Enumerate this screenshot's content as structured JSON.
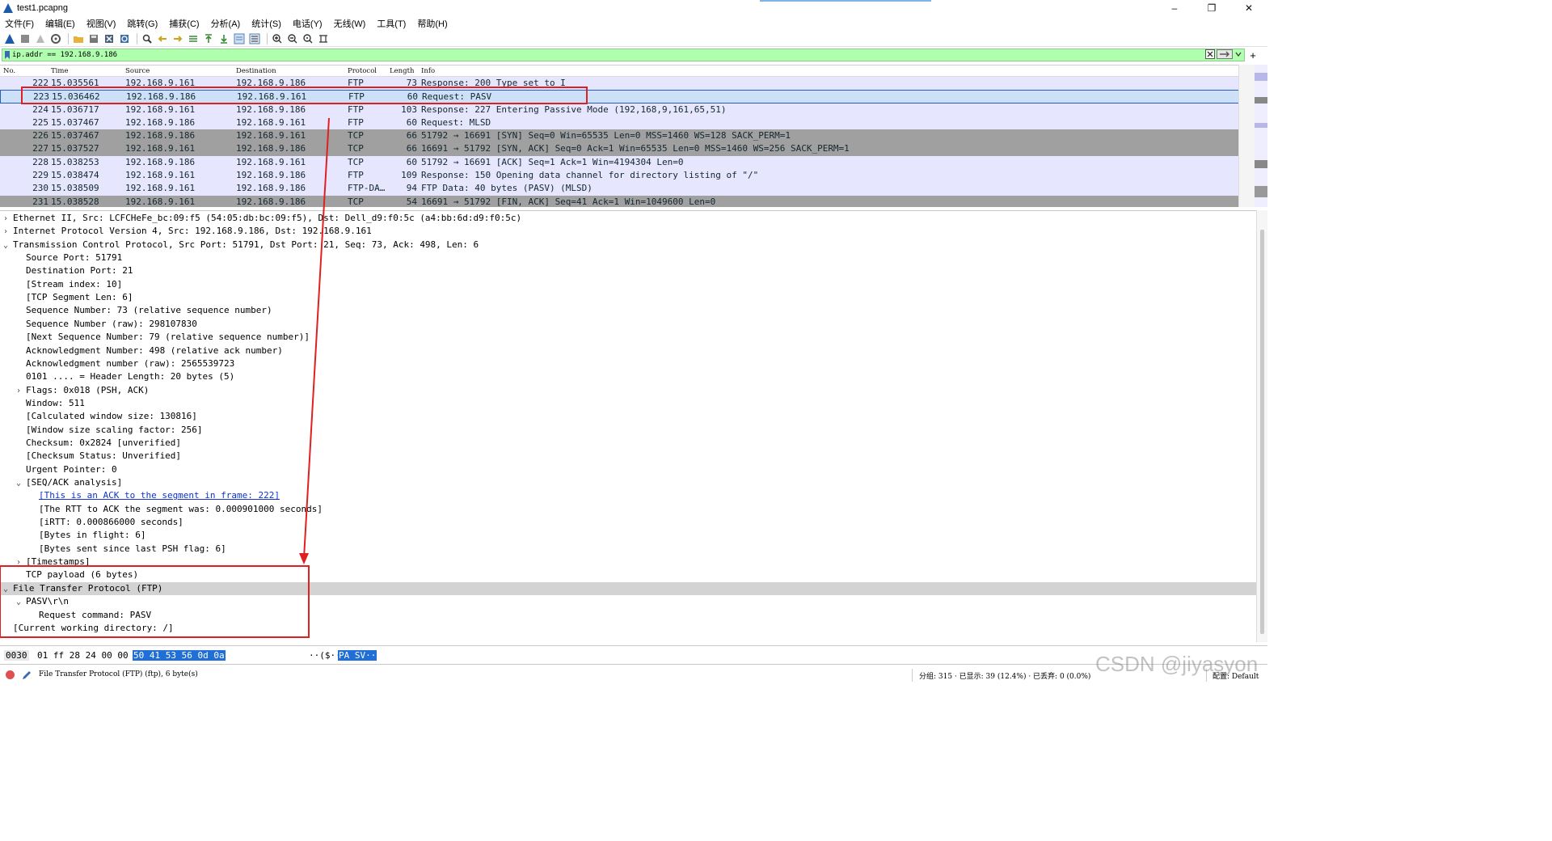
{
  "window": {
    "title": "test1.pcapng",
    "minimize": "–",
    "maximize": "❐",
    "close": "✕"
  },
  "menu": [
    "文件(F)",
    "编辑(E)",
    "视图(V)",
    "跳转(G)",
    "捕获(C)",
    "分析(A)",
    "统计(S)",
    "电话(Y)",
    "无线(W)",
    "工具(T)",
    "帮助(H)"
  ],
  "filter": {
    "value": "ip.addr == 192.168.9.186",
    "color": "#afffaf"
  },
  "packet_list": {
    "columns": {
      "no": "No.",
      "time": "Time",
      "source": "Source",
      "destination": "Destination",
      "protocol": "Protocol",
      "length": "Length",
      "info": "Info"
    },
    "rows": [
      {
        "no": "222",
        "time": "15.035561",
        "source": "192.168.9.161",
        "destination": "192.168.9.186",
        "protocol": "FTP",
        "length": "73",
        "info": "Response: 200 Type set to I",
        "bg": "#e7e6ff",
        "fg": "#12272e"
      },
      {
        "no": "223",
        "time": "15.036462",
        "source": "192.168.9.186",
        "destination": "192.168.9.161",
        "protocol": "FTP",
        "length": "60",
        "info": "Request: PASV",
        "bg": "#cce0f7",
        "fg": "#12272e",
        "selected": true
      },
      {
        "no": "224",
        "time": "15.036717",
        "source": "192.168.9.161",
        "destination": "192.168.9.186",
        "protocol": "FTP",
        "length": "103",
        "info": "Response: 227 Entering Passive Mode (192,168,9,161,65,51)",
        "bg": "#e7e6ff",
        "fg": "#12272e"
      },
      {
        "no": "225",
        "time": "15.037467",
        "source": "192.168.9.186",
        "destination": "192.168.9.161",
        "protocol": "FTP",
        "length": "60",
        "info": "Request: MLSD",
        "bg": "#e7e6ff",
        "fg": "#12272e"
      },
      {
        "no": "226",
        "time": "15.037467",
        "source": "192.168.9.186",
        "destination": "192.168.9.161",
        "protocol": "TCP",
        "length": "66",
        "info": "51792 → 16691 [SYN] Seq=0 Win=65535 Len=0 MSS=1460 WS=128 SACK_PERM=1",
        "bg": "#a0a0a0",
        "fg": "#12272e"
      },
      {
        "no": "227",
        "time": "15.037527",
        "source": "192.168.9.161",
        "destination": "192.168.9.186",
        "protocol": "TCP",
        "length": "66",
        "info": "16691 → 51792 [SYN, ACK] Seq=0 Ack=1 Win=65535 Len=0 MSS=1460 WS=256 SACK_PERM=1",
        "bg": "#a0a0a0",
        "fg": "#12272e"
      },
      {
        "no": "228",
        "time": "15.038253",
        "source": "192.168.9.186",
        "destination": "192.168.9.161",
        "protocol": "TCP",
        "length": "60",
        "info": "51792 → 16691 [ACK] Seq=1 Ack=1 Win=4194304 Len=0",
        "bg": "#e7e6ff",
        "fg": "#12272e"
      },
      {
        "no": "229",
        "time": "15.038474",
        "source": "192.168.9.161",
        "destination": "192.168.9.186",
        "protocol": "FTP",
        "length": "109",
        "info": "Response: 150 Opening data channel for directory listing of \"/\"",
        "bg": "#e7e6ff",
        "fg": "#12272e"
      },
      {
        "no": "230",
        "time": "15.038509",
        "source": "192.168.9.161",
        "destination": "192.168.9.186",
        "protocol": "FTP-DA…",
        "length": "94",
        "info": "FTP Data: 40 bytes (PASV) (MLSD)",
        "bg": "#e7e6ff",
        "fg": "#12272e"
      },
      {
        "no": "231",
        "time": "15.038528",
        "source": "192.168.9.161",
        "destination": "192.168.9.186",
        "protocol": "TCP",
        "length": "54",
        "info": "16691 → 51792 [FIN, ACK] Seq=41 Ack=1 Win=1049600 Len=0",
        "bg": "#a0a0a0",
        "fg": "#12272e"
      }
    ]
  },
  "details": [
    {
      "indent": 0,
      "arrow": "›",
      "text": "Ethernet II, Src: LCFCHeFe_bc:09:f5 (54:05:db:bc:09:f5), Dst: Dell_d9:f0:5c (a4:bb:6d:d9:f0:5c)"
    },
    {
      "indent": 0,
      "arrow": "›",
      "text": "Internet Protocol Version 4, Src: 192.168.9.186, Dst: 192.168.9.161"
    },
    {
      "indent": 0,
      "arrow": "⌄",
      "text": "Transmission Control Protocol, Src Port: 51791, Dst Port: 21, Seq: 73, Ack: 498, Len: 6"
    },
    {
      "indent": 1,
      "arrow": "",
      "text": "Source Port: 51791"
    },
    {
      "indent": 1,
      "arrow": "",
      "text": "Destination Port: 21"
    },
    {
      "indent": 1,
      "arrow": "",
      "text": "[Stream index: 10]"
    },
    {
      "indent": 1,
      "arrow": "",
      "text": "[TCP Segment Len: 6]"
    },
    {
      "indent": 1,
      "arrow": "",
      "text": "Sequence Number: 73    (relative sequence number)"
    },
    {
      "indent": 1,
      "arrow": "",
      "text": "Sequence Number (raw): 298107830"
    },
    {
      "indent": 1,
      "arrow": "",
      "text": "[Next Sequence Number: 79    (relative sequence number)]"
    },
    {
      "indent": 1,
      "arrow": "",
      "text": "Acknowledgment Number: 498    (relative ack number)"
    },
    {
      "indent": 1,
      "arrow": "",
      "text": "Acknowledgment number (raw): 2565539723"
    },
    {
      "indent": 1,
      "arrow": "",
      "text": "0101 .... = Header Length: 20 bytes (5)"
    },
    {
      "indent": 1,
      "arrow": "›",
      "text": "Flags: 0x018 (PSH, ACK)"
    },
    {
      "indent": 1,
      "arrow": "",
      "text": "Window: 511"
    },
    {
      "indent": 1,
      "arrow": "",
      "text": "[Calculated window size: 130816]"
    },
    {
      "indent": 1,
      "arrow": "",
      "text": "[Window size scaling factor: 256]"
    },
    {
      "indent": 1,
      "arrow": "",
      "text": "Checksum: 0x2824 [unverified]"
    },
    {
      "indent": 1,
      "arrow": "",
      "text": "[Checksum Status: Unverified]"
    },
    {
      "indent": 1,
      "arrow": "",
      "text": "Urgent Pointer: 0"
    },
    {
      "indent": 1,
      "arrow": "⌄",
      "text": "[SEQ/ACK analysis]"
    },
    {
      "indent": 2,
      "arrow": "",
      "text": "[This is an ACK to the segment in frame: 222]",
      "link": true
    },
    {
      "indent": 2,
      "arrow": "",
      "text": "[The RTT to ACK the segment was: 0.000901000 seconds]"
    },
    {
      "indent": 2,
      "arrow": "",
      "text": "[iRTT: 0.000866000 seconds]"
    },
    {
      "indent": 2,
      "arrow": "",
      "text": "[Bytes in flight: 6]"
    },
    {
      "indent": 2,
      "arrow": "",
      "text": "[Bytes sent since last PSH flag: 6]"
    },
    {
      "indent": 1,
      "arrow": "›",
      "text": "[Timestamps]"
    },
    {
      "indent": 1,
      "arrow": "",
      "text": "TCP payload (6 bytes)"
    },
    {
      "indent": 0,
      "arrow": "⌄",
      "text": "File Transfer Protocol (FTP)",
      "highlight": true
    },
    {
      "indent": 1,
      "arrow": "⌄",
      "text": "PASV\\r\\n"
    },
    {
      "indent": 2,
      "arrow": "",
      "text": "Request command: PASV"
    },
    {
      "indent": 0,
      "arrow": "",
      "text": "[Current working directory: /]"
    }
  ],
  "bytes": {
    "offset": "0030",
    "hex_plain": "01 ff 28 24 00 00",
    "hex_selected": "50 41  53 56 0d 0a",
    "ascii_plain": "··($··",
    "ascii_selected": "PA SV··"
  },
  "status": {
    "text": "File Transfer Protocol (FTP) (ftp), 6 byte(s)",
    "stats": "分组: 315 · 已显示: 39 (12.4%) · 已丢弃: 0 (0.0%)",
    "profile": "配置: Default"
  },
  "watermark": "CSDN @jiyasyon",
  "colors": {
    "annotation": "#e02020",
    "selection_border": "#2a5dbc",
    "byte_highlight": "#1f6fd6"
  }
}
